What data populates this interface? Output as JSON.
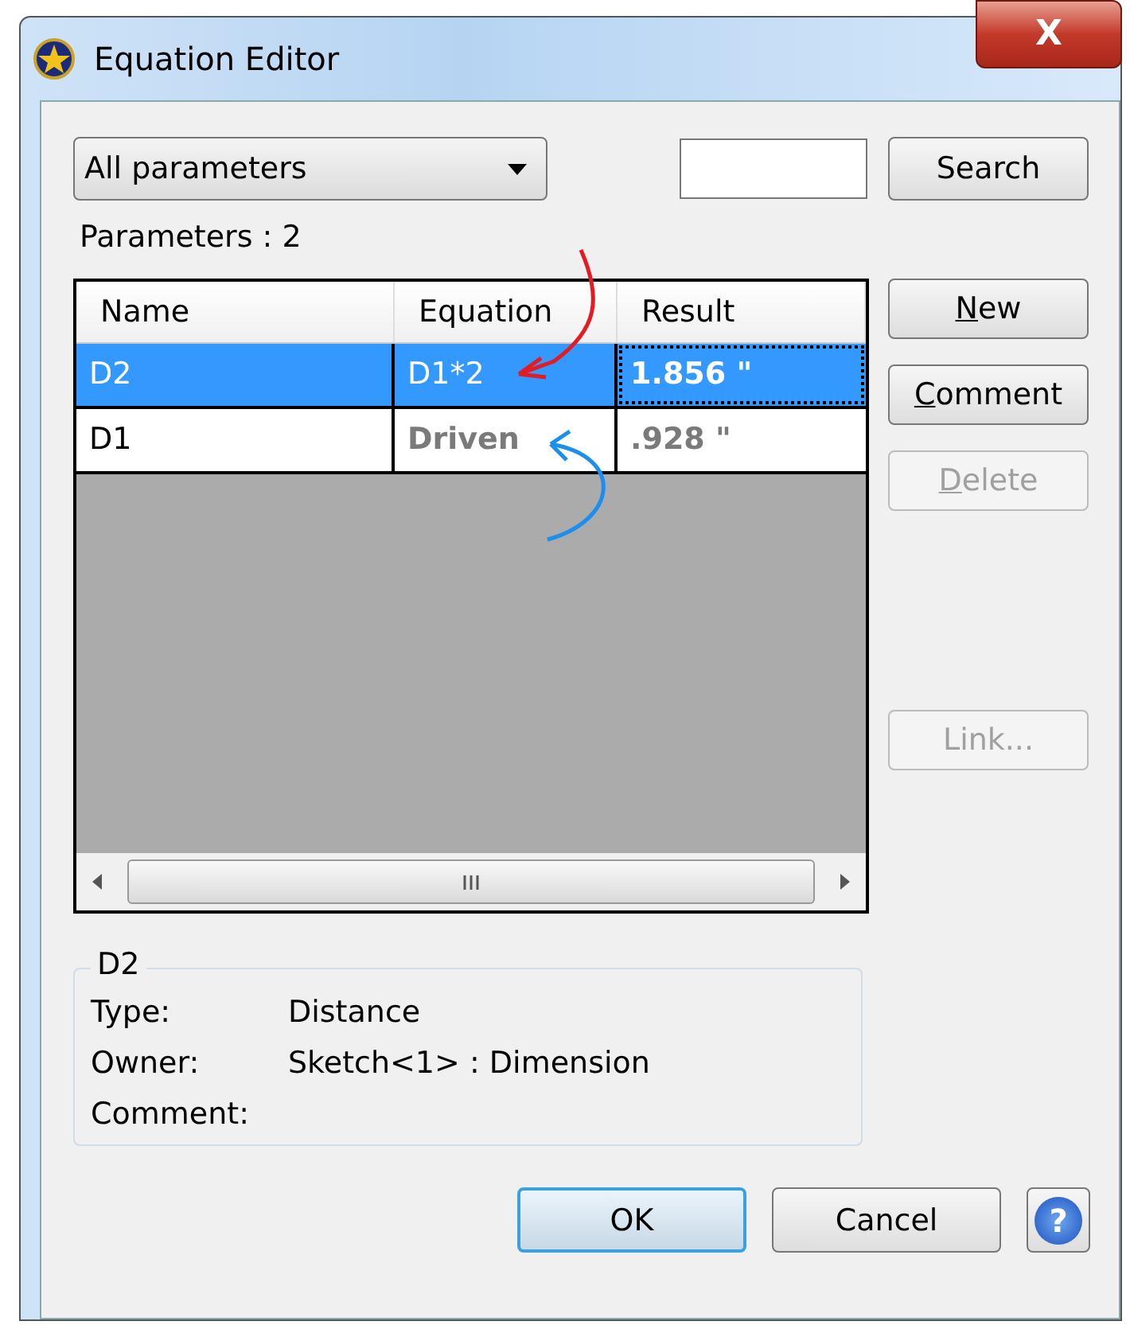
{
  "window": {
    "title": "Equation Editor",
    "close": "X"
  },
  "filter": {
    "value": "All parameters"
  },
  "search": {
    "button": "Search"
  },
  "count_label": "Parameters :  2",
  "table": {
    "columns": [
      "Name",
      "Equation",
      "Result"
    ],
    "rows": [
      {
        "name": "D2",
        "equation": "D1*2",
        "result": "1.856 \"",
        "selected": true,
        "driven": false
      },
      {
        "name": "D1",
        "equation": "Driven",
        "result": ".928 \"",
        "selected": false,
        "driven": true
      }
    ]
  },
  "side_buttons": [
    {
      "label": "New",
      "underline_first": true,
      "disabled": false
    },
    {
      "label": "Comment",
      "underline_first": true,
      "disabled": false
    },
    {
      "label": "Delete",
      "underline_first": true,
      "disabled": true
    },
    {
      "label": "Link...",
      "underline_first": false,
      "disabled": true
    }
  ],
  "details": {
    "title": "D2",
    "fields": [
      {
        "label": "Type:",
        "value": "Distance"
      },
      {
        "label": "Owner:",
        "value": "Sketch<1> : Dimension"
      },
      {
        "label": "Comment:"
      }
    ]
  },
  "buttons": [
    {
      "label": "OK",
      "default": true
    },
    {
      "label": "Cancel",
      "default": false
    }
  ],
  "help_button": {
    "glyph": "?"
  }
}
